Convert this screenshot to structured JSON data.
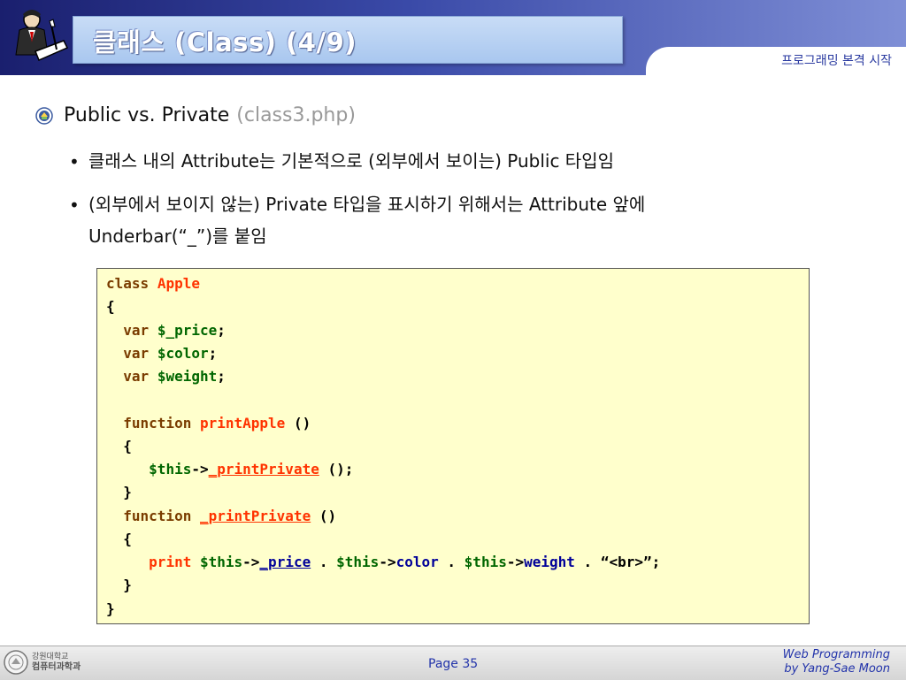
{
  "header": {
    "title": "클래스 (Class) (4/9)",
    "course_tag": "프로그래밍 본격 시작"
  },
  "bullets": {
    "main_label": "Public vs. Private",
    "main_file": "(class3.php)",
    "sub1_marker": "•",
    "sub1": "클래스 내의 Attribute는 기본적으로 (외부에서 보이는) Public 타입임",
    "sub2_marker": "•",
    "sub2_line1": "(외부에서 보이지 않는) Private 타입을 표시하기 위해서는 Attribute 앞에",
    "sub2_line2": "Underbar(“_”)를 붙임"
  },
  "code": {
    "l1_kw": "class",
    "l1_name": "Apple",
    "l2": "{",
    "l3_kw": "var",
    "l3_var": "$_price",
    "semi": ";",
    "l4_kw": "var",
    "l4_var": "$color",
    "l5_kw": "var",
    "l5_var": "$weight",
    "l7_kw": "function",
    "l7_name": "printApple",
    "parens": "()",
    "l8": "{",
    "l9_var": "$this",
    "arrow": "->",
    "l9_name": "_printPrivate",
    "l9_call": "();",
    "l10": "}",
    "l11_kw": "function",
    "l11_name": "_printPrivate",
    "l12": "{",
    "l13_print": "print",
    "l13_this1": "$this",
    "l13_p1": "_price",
    "dot": ".",
    "l13_this2": "$this",
    "l13_p2": "color",
    "l13_this3": "$this",
    "l13_p3": "weight",
    "l13_str": "“<br>”;",
    "l14": "}",
    "l15": "}"
  },
  "footer": {
    "school_line1": "강원대학교",
    "school_line2": "컴퓨터과학과",
    "page": "Page 35",
    "credit_line1": "Web Programming",
    "credit_line2": "by Yang-Sae Moon"
  },
  "colors": {
    "header_dark": "#1a1f6e",
    "code_bg": "#ffffcc",
    "keyword": "#7a3c00",
    "name": "#ff3300",
    "variable": "#006600",
    "property": "#000099",
    "accent_text": "#2233aa"
  },
  "icons": [
    "clerk-writing-logo-icon",
    "university-emblem-bullet-icon",
    "university-seal-icon"
  ]
}
